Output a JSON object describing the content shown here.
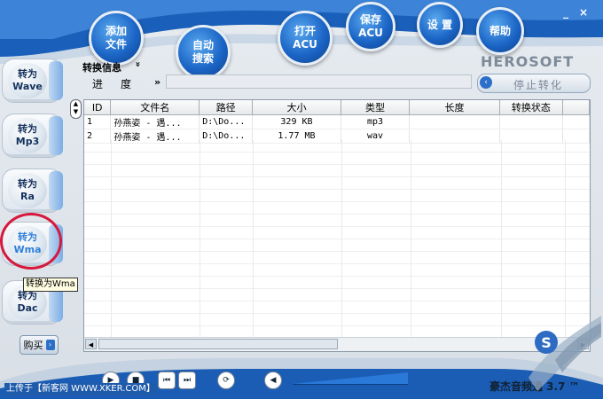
{
  "window": {
    "minimize": "_",
    "close": "×"
  },
  "toolbar": [
    {
      "name": "add-file-button",
      "label": "添加\n文件"
    },
    {
      "name": "auto-search-button",
      "label": "自动\n搜索"
    },
    {
      "name": "open-acu-button",
      "label": "打开\nACU"
    },
    {
      "name": "save-acu-button",
      "label": "保存\nACU"
    },
    {
      "name": "settings-button",
      "label": "设 置"
    },
    {
      "name": "help-button",
      "label": "帮助"
    }
  ],
  "sidebar": [
    {
      "name": "convert-wave-button",
      "label": "转为\nWave"
    },
    {
      "name": "convert-mp3-button",
      "label": "转为\nMp3"
    },
    {
      "name": "convert-ra-button",
      "label": "转为\nRa"
    },
    {
      "name": "convert-wma-button",
      "label": "转为\nWma"
    },
    {
      "name": "convert-dac-button",
      "label": "转为\nDac"
    }
  ],
  "tooltip": "转换为Wma",
  "buy": {
    "label": "购买",
    "arrow": "›"
  },
  "info": {
    "label": "转换信息",
    "chevron": "»",
    "progress_label": "进度",
    "progress_chevron": "»"
  },
  "brand": "HEROSOFT",
  "stop": {
    "label": "停止转化",
    "arrow": "‹"
  },
  "table": {
    "columns": [
      "ID",
      "文件名",
      "路径",
      "大小",
      "类型",
      "长度",
      "转换状态"
    ],
    "rows": [
      [
        "1",
        "孙燕姿 - 遇...",
        "D:\\Do...",
        "329 KB",
        "mp3",
        "",
        ""
      ],
      [
        "2",
        "孙燕姿 - 遇...",
        "D:\\Do...",
        "1.77 MB",
        "wav",
        "",
        ""
      ]
    ]
  },
  "footer": "上传于【新客网 WWW.XKER.COM】",
  "app_title": "豪杰音频通 3.7 ™",
  "watermark": "S",
  "controls": {
    "play": "▶",
    "stop": "■",
    "prev": "⏮",
    "next": "⏭",
    "loop": "⟳",
    "volume": "◀"
  }
}
